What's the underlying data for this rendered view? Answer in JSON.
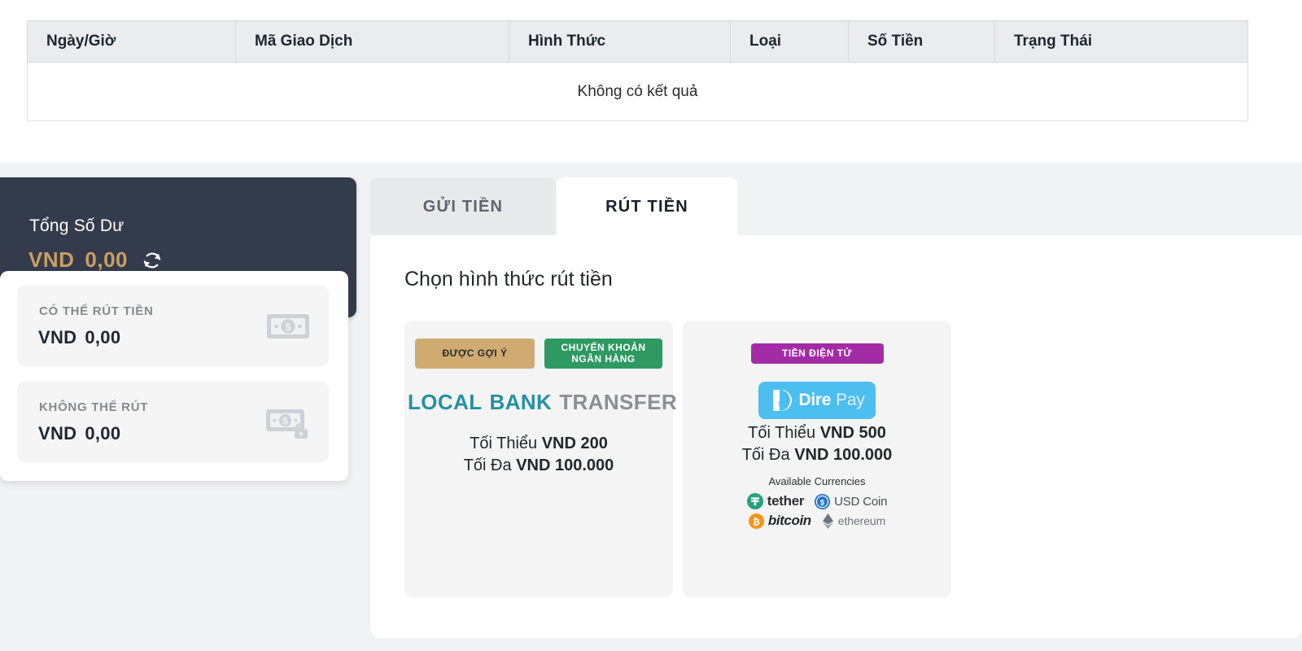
{
  "transactions_table": {
    "columns": [
      "Ngày/Giờ",
      "Mã Giao Dịch",
      "Hình Thức",
      "Loại",
      "Số Tiền",
      "Trạng Thái"
    ],
    "empty_message": "Không có kết quả",
    "rows": []
  },
  "balance": {
    "title": "Tổng Số Dư",
    "currency": "VND",
    "amount": "0,00",
    "refresh_icon": "refresh-icon",
    "items": [
      {
        "label": "CÓ THỂ RÚT TIỀN",
        "currency": "VND",
        "amount": "0,00",
        "icon": "banknote-icon"
      },
      {
        "label": "KHÔNG THỂ RÚT",
        "currency": "VND",
        "amount": "0,00",
        "icon": "banknote-lock-icon"
      }
    ]
  },
  "tabs": [
    {
      "label": "GỬI TIỀN",
      "active": false
    },
    {
      "label": "RÚT TIỀN",
      "active": true
    }
  ],
  "panel": {
    "heading": "Chọn hình thức rút tiền"
  },
  "methods": [
    {
      "id": "local-bank-transfer",
      "badges": [
        {
          "text": "ĐƯỢC GỢI Ý",
          "color": "#cfab72"
        },
        {
          "text": "CHUYỂN KHOẢN NGÂN HÀNG",
          "line1": "CHUYỂN KHOẢN",
          "line2": "NGÂN HÀNG",
          "color": "#2e9960"
        }
      ],
      "logo": {
        "icon": "bank-building-icon",
        "word1": "LOCAL",
        "word2": "BANK",
        "word3": "TRANSFER"
      },
      "min_label": "Tối Thiểu",
      "min_value": "VND 200",
      "max_label": "Tối Đa",
      "max_value": "VND 100.000"
    },
    {
      "id": "direpay-crypto",
      "badges": [
        {
          "text": "TIỀN ĐIỆN TỬ",
          "color": "#a32ba6"
        }
      ],
      "logo": {
        "icon": "direpay-icon",
        "word1": "Dire",
        "word2": "Pay"
      },
      "min_label": "Tối Thiểu",
      "min_value": "VND 500",
      "max_label": "Tối Đa",
      "max_value": "VND 100.000",
      "currencies_label": "Available Currencies",
      "currencies": [
        {
          "name": "tether",
          "icon": "tether-icon",
          "color": "#26a17b"
        },
        {
          "name": "USD Coin",
          "icon": "usdcoin-icon",
          "color": "#2775ca"
        },
        {
          "name": "bitcoin",
          "icon": "bitcoin-icon",
          "color": "#f7931a"
        },
        {
          "name": "ethereum",
          "icon": "ethereum-icon",
          "color": "#627eea"
        }
      ]
    }
  ],
  "colors": {
    "balance_card_bg": "#343b4c",
    "balance_amount": "#c8a063",
    "page_bg": "#f1f2f3",
    "table_header_bg": "#eaecef",
    "bank_teal": "#2391a3",
    "direpay_blue": "#4cbeef"
  }
}
